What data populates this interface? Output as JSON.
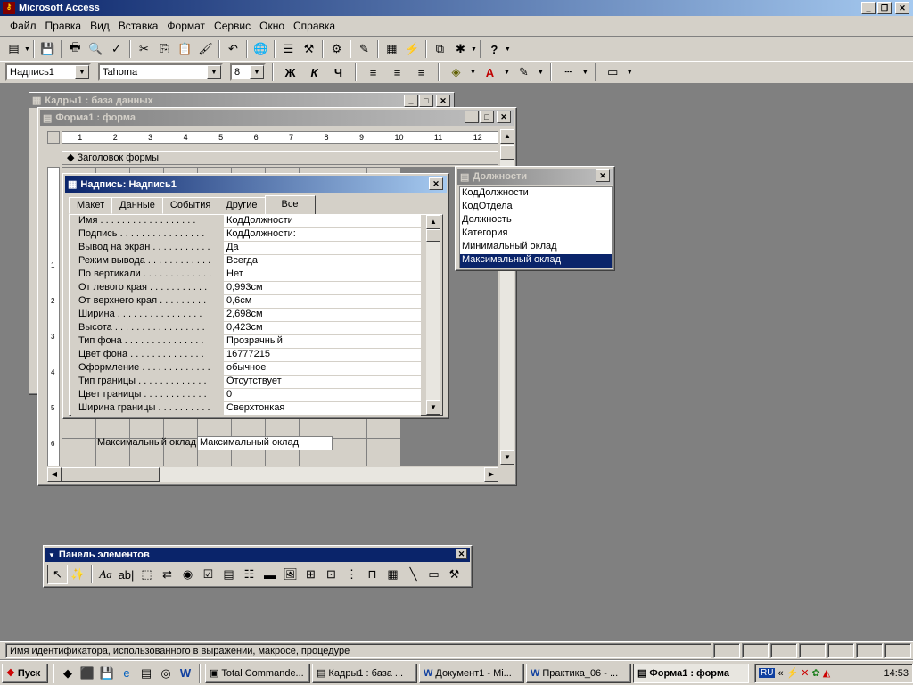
{
  "app": {
    "title": "Microsoft Access",
    "title_icon": "key-icon"
  },
  "menu": [
    "Файл",
    "Правка",
    "Вид",
    "Вставка",
    "Формат",
    "Сервис",
    "Окно",
    "Справка"
  ],
  "format_bar": {
    "object": "Надпись1",
    "font": "Tahoma",
    "size": "8",
    "bold": "Ж",
    "italic": "К",
    "underline": "Ч"
  },
  "db_window": {
    "title": "Кадры1 : база данных"
  },
  "form_window": {
    "title": "Форма1 : форма",
    "section_header": "Заголовок формы",
    "ruler_marks": [
      "1",
      "2",
      "3",
      "4",
      "5",
      "6",
      "7",
      "8",
      "9",
      "10",
      "11",
      "12"
    ],
    "vruler": [
      "1",
      "2",
      "3",
      "4",
      "5",
      "6"
    ],
    "label_text": "Максимальный оклад",
    "field_text": "Максимальный оклад"
  },
  "props": {
    "title": "Надпись: Надпись1",
    "tabs": [
      "Макет",
      "Данные",
      "События",
      "Другие",
      "Все"
    ],
    "active_tab": "Все",
    "rows": [
      {
        "name": "Имя . . . . . . . . . . . . . . . . . .",
        "value": "КодДолжности"
      },
      {
        "name": "Подпись . . . . . . . . . . . . . . . .",
        "value": "КодДолжности:"
      },
      {
        "name": "Вывод на экран . . . . . . . . . . .",
        "value": "Да"
      },
      {
        "name": "Режим вывода . . . . . . . . . . . .",
        "value": "Всегда"
      },
      {
        "name": "По вертикали . . . . . . . . . . . . .",
        "value": "Нет"
      },
      {
        "name": "От левого края . . . . . . . . . . .",
        "value": "0,993см"
      },
      {
        "name": "От верхнего края . . . . . . . . .",
        "value": "0,6см"
      },
      {
        "name": "Ширина . . . . . . . . . . . . . . . .",
        "value": "2,698см"
      },
      {
        "name": "Высота . . . . . . . . . . . . . . . . .",
        "value": "0,423см"
      },
      {
        "name": "Тип фона . . . . . . . . . . . . . . .",
        "value": "Прозрачный"
      },
      {
        "name": "Цвет фона . . . . . . . . . . . . . .",
        "value": "16777215"
      },
      {
        "name": "Оформление . . . . . . . . . . . . .",
        "value": "обычное"
      },
      {
        "name": "Тип границы . . . . . . . . . . . . .",
        "value": "Отсутствует"
      },
      {
        "name": "Цвет границы . . . . . . . . . . . .",
        "value": "0"
      },
      {
        "name": "Ширина границы . . . . . . . . . .",
        "value": "Сверхтонкая"
      }
    ]
  },
  "fieldlist": {
    "title": "Должности",
    "items": [
      "КодДолжности",
      "КодОтдела",
      "Должность",
      "Категория",
      "Минимальный оклад",
      "Максимальный оклад"
    ],
    "selected": "Максимальный оклад"
  },
  "toolbox": {
    "title": "Панель элементов",
    "tools": [
      "arrow-tool-icon",
      "wizard-icon",
      "label-icon",
      "textbox-icon",
      "option-group-icon",
      "toggle-icon",
      "option-button-icon",
      "checkbox-icon",
      "combobox-icon",
      "listbox-icon",
      "command-button-icon",
      "image-icon",
      "unbound-frame-icon",
      "bound-frame-icon",
      "page-break-icon",
      "tab-control-icon",
      "subform-icon",
      "line-icon",
      "rectangle-icon",
      "more-tools-icon"
    ]
  },
  "status": {
    "text": "Имя идентификатора, использованного в выражении, макросе, процедуре"
  },
  "taskbar": {
    "start": "Пуск",
    "tasks": [
      "Total Commande...",
      "Кадры1 : база ...",
      "Документ1 - Mi...",
      "Практика_06 - ...",
      "Форма1 : форма"
    ],
    "active_task": "Форма1 : форма",
    "lang": "RU",
    "clock": "14:53"
  }
}
